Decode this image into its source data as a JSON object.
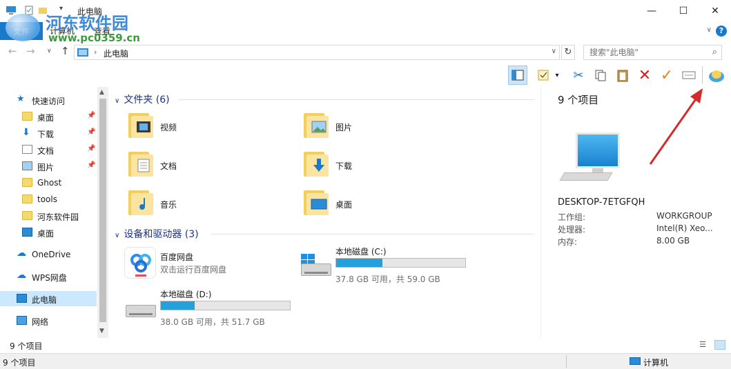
{
  "window": {
    "title": "此电脑",
    "minimize": "—",
    "maximize": "☐",
    "close": "✕"
  },
  "ribbon": {
    "tabs": [
      "文件",
      "计算机",
      "查看"
    ],
    "collapse": "∨",
    "help": "?"
  },
  "address": {
    "path": "此电脑",
    "search_placeholder": "搜索\"此电脑\"",
    "refresh": "↻",
    "back": "←",
    "forward": "→",
    "recent": "∨",
    "up": "↑"
  },
  "nav": {
    "quick_access": "快速访问",
    "quick_items": [
      "桌面",
      "下载",
      "文档",
      "图片",
      "Ghost",
      "tools",
      "河东软件园",
      "桌面"
    ],
    "onedrive": "OneDrive",
    "wps": "WPS网盘",
    "this_pc": "此电脑",
    "network": "网络"
  },
  "content": {
    "folders_header": "文件夹 (6)",
    "folders": [
      "视频",
      "图片",
      "文档",
      "下载",
      "音乐",
      "桌面"
    ],
    "devices_header": "设备和驱动器 (3)",
    "baidu": {
      "name": "百度网盘",
      "sub": "双击运行百度网盘"
    },
    "drive_c": {
      "name": "本地磁盘 (C:)",
      "sub": "37.8 GB 可用，共 59.0 GB",
      "used_fraction": 0.36
    },
    "drive_d": {
      "name": "本地磁盘 (D:)",
      "sub": "38.0 GB 可用，共 51.7 GB",
      "used_fraction": 0.26
    }
  },
  "details": {
    "count": "9 个项目",
    "computer_name": "DESKTOP-7ETGFQH",
    "props": [
      {
        "label": "工作组:",
        "value": "WORKGROUP"
      },
      {
        "label": "处理器:",
        "value": "Intel(R) Xeo..."
      },
      {
        "label": "内存:",
        "value": "8.00 GB"
      }
    ]
  },
  "status": {
    "view_count": "9 个项目",
    "left": "9 个项目",
    "right": "计算机"
  },
  "watermark": {
    "text": "河东软件园",
    "url": "www.pc0359.cn"
  },
  "colors": {
    "accent": "#1979ca",
    "folder": "#f3cf5e",
    "drive_fill": "#26a0da",
    "header_text": "#1e3287",
    "arrow": "#d42a2a"
  }
}
